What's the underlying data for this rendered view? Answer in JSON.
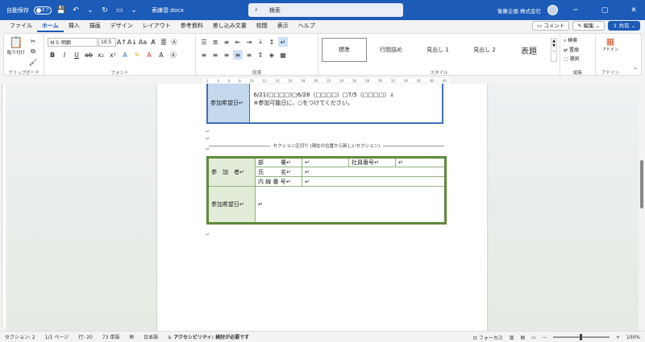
{
  "titlebar": {
    "autosave_label": "自動保存",
    "autosave_state": "オフ",
    "filename": "表練習.docx",
    "search_placeholder": "検索",
    "user": "後藤企画 株式会社",
    "accent": "#1c5bb8"
  },
  "menu": {
    "tabs": [
      "ファイル",
      "ホーム",
      "挿入",
      "描画",
      "デザイン",
      "レイアウト",
      "参考資料",
      "差し込み文書",
      "校閲",
      "表示",
      "ヘルプ"
    ],
    "active": "ホーム",
    "comment_btn": "コメント",
    "edit_btn": "編集",
    "share_btn": "共有"
  },
  "ribbon": {
    "clipboard": {
      "paste": "貼り付け",
      "label": "クリップボード"
    },
    "font": {
      "name": "ＭＳ 明朝",
      "size": "10.5",
      "label": "フォント"
    },
    "paragraph": {
      "label": "段落"
    },
    "styles": {
      "items": [
        "標準",
        "行間詰め",
        "見出し 1",
        "見出し 2",
        "表題"
      ],
      "label": "スタイル"
    },
    "editing": {
      "find": "検索",
      "replace": "置換",
      "select": "選択",
      "label": "編集"
    },
    "addin": {
      "name": "アドイン",
      "label": "アドイン"
    }
  },
  "doc": {
    "table1": {
      "label": "参加希望日",
      "line1": "6/21(□□□□)□6/28（□□□□）□7/5（□□□□）↓",
      "line2": "※参加可能日に、○をつけてください。"
    },
    "section_break": "セクション区切り (現在の位置から新しいセクション)",
    "table2": {
      "participant": "参　加　者",
      "dept": "部　　　署",
      "employee_no": "社員番号",
      "name": "氏　　　名",
      "ext": "内 線 番 号",
      "date_label": "参加希望日"
    }
  },
  "status": {
    "section": "セクション: 2",
    "page": "1/1 ページ",
    "line": "行: 20",
    "words": "73 単語",
    "lang": "日本語",
    "accessibility": "アクセシビリティ: 検討が必要です",
    "focus": "フォーカス",
    "zoom": "100%"
  }
}
